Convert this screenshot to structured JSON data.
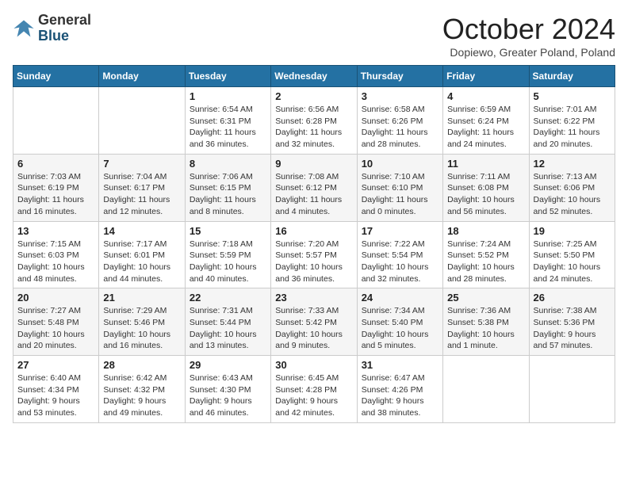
{
  "logo": {
    "general": "General",
    "blue": "Blue"
  },
  "title": "October 2024",
  "location": "Dopiewo, Greater Poland, Poland",
  "days_of_week": [
    "Sunday",
    "Monday",
    "Tuesday",
    "Wednesday",
    "Thursday",
    "Friday",
    "Saturday"
  ],
  "weeks": [
    [
      {
        "day": "",
        "info": ""
      },
      {
        "day": "",
        "info": ""
      },
      {
        "day": "1",
        "info": "Sunrise: 6:54 AM\nSunset: 6:31 PM\nDaylight: 11 hours and 36 minutes."
      },
      {
        "day": "2",
        "info": "Sunrise: 6:56 AM\nSunset: 6:28 PM\nDaylight: 11 hours and 32 minutes."
      },
      {
        "day": "3",
        "info": "Sunrise: 6:58 AM\nSunset: 6:26 PM\nDaylight: 11 hours and 28 minutes."
      },
      {
        "day": "4",
        "info": "Sunrise: 6:59 AM\nSunset: 6:24 PM\nDaylight: 11 hours and 24 minutes."
      },
      {
        "day": "5",
        "info": "Sunrise: 7:01 AM\nSunset: 6:22 PM\nDaylight: 11 hours and 20 minutes."
      }
    ],
    [
      {
        "day": "6",
        "info": "Sunrise: 7:03 AM\nSunset: 6:19 PM\nDaylight: 11 hours and 16 minutes."
      },
      {
        "day": "7",
        "info": "Sunrise: 7:04 AM\nSunset: 6:17 PM\nDaylight: 11 hours and 12 minutes."
      },
      {
        "day": "8",
        "info": "Sunrise: 7:06 AM\nSunset: 6:15 PM\nDaylight: 11 hours and 8 minutes."
      },
      {
        "day": "9",
        "info": "Sunrise: 7:08 AM\nSunset: 6:12 PM\nDaylight: 11 hours and 4 minutes."
      },
      {
        "day": "10",
        "info": "Sunrise: 7:10 AM\nSunset: 6:10 PM\nDaylight: 11 hours and 0 minutes."
      },
      {
        "day": "11",
        "info": "Sunrise: 7:11 AM\nSunset: 6:08 PM\nDaylight: 10 hours and 56 minutes."
      },
      {
        "day": "12",
        "info": "Sunrise: 7:13 AM\nSunset: 6:06 PM\nDaylight: 10 hours and 52 minutes."
      }
    ],
    [
      {
        "day": "13",
        "info": "Sunrise: 7:15 AM\nSunset: 6:03 PM\nDaylight: 10 hours and 48 minutes."
      },
      {
        "day": "14",
        "info": "Sunrise: 7:17 AM\nSunset: 6:01 PM\nDaylight: 10 hours and 44 minutes."
      },
      {
        "day": "15",
        "info": "Sunrise: 7:18 AM\nSunset: 5:59 PM\nDaylight: 10 hours and 40 minutes."
      },
      {
        "day": "16",
        "info": "Sunrise: 7:20 AM\nSunset: 5:57 PM\nDaylight: 10 hours and 36 minutes."
      },
      {
        "day": "17",
        "info": "Sunrise: 7:22 AM\nSunset: 5:54 PM\nDaylight: 10 hours and 32 minutes."
      },
      {
        "day": "18",
        "info": "Sunrise: 7:24 AM\nSunset: 5:52 PM\nDaylight: 10 hours and 28 minutes."
      },
      {
        "day": "19",
        "info": "Sunrise: 7:25 AM\nSunset: 5:50 PM\nDaylight: 10 hours and 24 minutes."
      }
    ],
    [
      {
        "day": "20",
        "info": "Sunrise: 7:27 AM\nSunset: 5:48 PM\nDaylight: 10 hours and 20 minutes."
      },
      {
        "day": "21",
        "info": "Sunrise: 7:29 AM\nSunset: 5:46 PM\nDaylight: 10 hours and 16 minutes."
      },
      {
        "day": "22",
        "info": "Sunrise: 7:31 AM\nSunset: 5:44 PM\nDaylight: 10 hours and 13 minutes."
      },
      {
        "day": "23",
        "info": "Sunrise: 7:33 AM\nSunset: 5:42 PM\nDaylight: 10 hours and 9 minutes."
      },
      {
        "day": "24",
        "info": "Sunrise: 7:34 AM\nSunset: 5:40 PM\nDaylight: 10 hours and 5 minutes."
      },
      {
        "day": "25",
        "info": "Sunrise: 7:36 AM\nSunset: 5:38 PM\nDaylight: 10 hours and 1 minute."
      },
      {
        "day": "26",
        "info": "Sunrise: 7:38 AM\nSunset: 5:36 PM\nDaylight: 9 hours and 57 minutes."
      }
    ],
    [
      {
        "day": "27",
        "info": "Sunrise: 6:40 AM\nSunset: 4:34 PM\nDaylight: 9 hours and 53 minutes."
      },
      {
        "day": "28",
        "info": "Sunrise: 6:42 AM\nSunset: 4:32 PM\nDaylight: 9 hours and 49 minutes."
      },
      {
        "day": "29",
        "info": "Sunrise: 6:43 AM\nSunset: 4:30 PM\nDaylight: 9 hours and 46 minutes."
      },
      {
        "day": "30",
        "info": "Sunrise: 6:45 AM\nSunset: 4:28 PM\nDaylight: 9 hours and 42 minutes."
      },
      {
        "day": "31",
        "info": "Sunrise: 6:47 AM\nSunset: 4:26 PM\nDaylight: 9 hours and 38 minutes."
      },
      {
        "day": "",
        "info": ""
      },
      {
        "day": "",
        "info": ""
      }
    ]
  ]
}
